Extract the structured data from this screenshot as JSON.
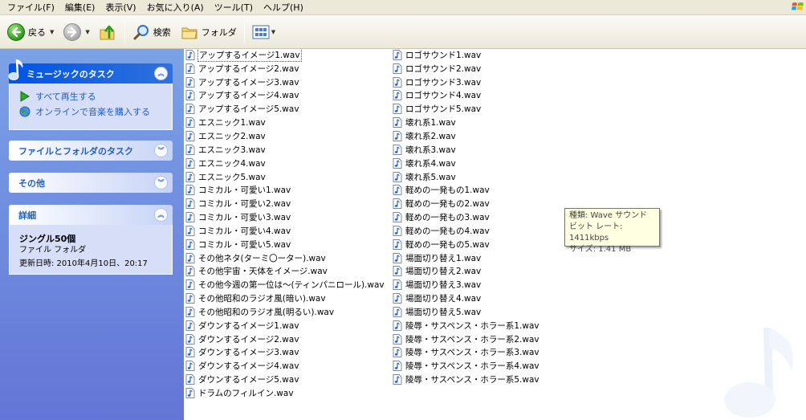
{
  "menu": [
    "ファイル(F)",
    "編集(E)",
    "表示(V)",
    "お気に入り(A)",
    "ツール(T)",
    "ヘルプ(H)"
  ],
  "toolbar": {
    "back_label": "戻る",
    "search_label": "検索",
    "folders_label": "フォルダ"
  },
  "taskpane": {
    "music_tasks": {
      "title": "ミュージックのタスク",
      "items": [
        "すべて再生する",
        "オンラインで音楽を購入する"
      ]
    },
    "file_folder_tasks": {
      "title": "ファイルとフォルダのタスク"
    },
    "other": {
      "title": "その他"
    },
    "details": {
      "title": "詳細",
      "name": "ジングル50個",
      "type": "ファイル フォルダ",
      "modified": "更新日時: 2010年4月10日、20:17"
    }
  },
  "files": {
    "col1": [
      "アップするイメージ1.wav",
      "アップするイメージ2.wav",
      "アップするイメージ3.wav",
      "アップするイメージ4.wav",
      "アップするイメージ5.wav",
      "エスニック1.wav",
      "エスニック2.wav",
      "エスニック3.wav",
      "エスニック4.wav",
      "エスニック5.wav",
      "コミカル・可愛い1.wav",
      "コミカル・可愛い2.wav",
      "コミカル・可愛い3.wav",
      "コミカル・可愛い4.wav",
      "コミカル・可愛い5.wav",
      "その他ネタ(ターミ〇ーター).wav",
      "その他宇宙・天体をイメージ.wav",
      "その他今週の第一位は〜(ティンパニロール).wav",
      "その他昭和のラジオ風(暗い).wav",
      "その他昭和のラジオ風(明るい).wav",
      "ダウンするイメージ1.wav",
      "ダウンするイメージ2.wav",
      "ダウンするイメージ3.wav",
      "ダウンするイメージ4.wav",
      "ダウンするイメージ5.wav",
      "ドラムのフィルイン.wav"
    ],
    "col2": [
      "ロゴサウンド1.wav",
      "ロゴサウンド2.wav",
      "ロゴサウンド3.wav",
      "ロゴサウンド4.wav",
      "ロゴサウンド5.wav",
      "壊れ系1.wav",
      "壊れ系2.wav",
      "壊れ系3.wav",
      "壊れ系4.wav",
      "壊れ系5.wav",
      "軽めの一発もの1.wav",
      "軽めの一発もの2.wav",
      "軽めの一発もの3.wav",
      "軽めの一発もの4.wav",
      "軽めの一発もの5.wav",
      "場面切り替え1.wav",
      "場面切り替え2.wav",
      "場面切り替え3.wav",
      "場面切り替え4.wav",
      "場面切り替え5.wav",
      "陵辱・サスペンス・ホラー系1.wav",
      "陵辱・サスペンス・ホラー系2.wav",
      "陵辱・サスペンス・ホラー系3.wav",
      "陵辱・サスペンス・ホラー系4.wav",
      "陵辱・サスペンス・ホラー系5.wav"
    ]
  },
  "tooltip": {
    "line1": "種類: Wave サウンド",
    "line2": "ビット レート: 1411kbps",
    "line3": "サイズ: 1.41 MB"
  },
  "colors": {
    "menubar": "#ece9d8",
    "taskpane_top": "#7ba2e7",
    "taskpane_bottom": "#6375d6",
    "panel_body": "#d6dff7",
    "link": "#215dc6",
    "tooltip_bg": "#ffffe1"
  }
}
